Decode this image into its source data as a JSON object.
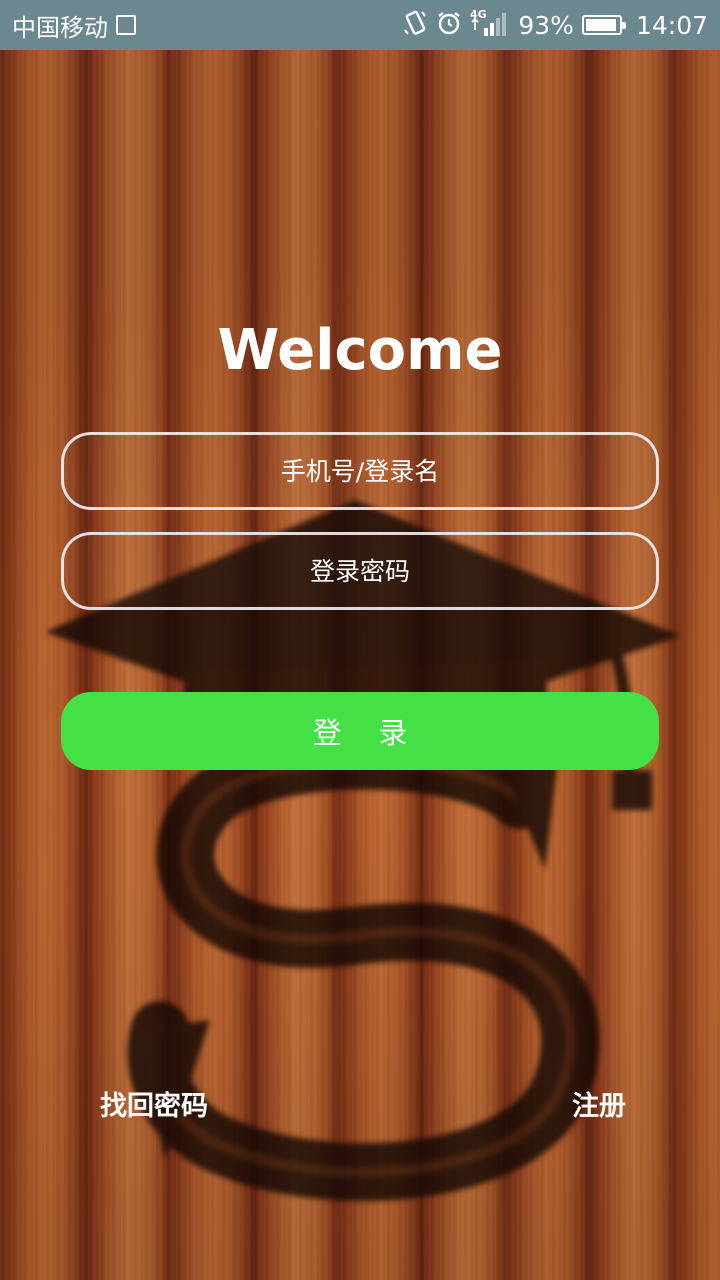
{
  "status_bar": {
    "carrier": "中国移动",
    "network": "4G",
    "battery_percent": "93%",
    "battery_level": 0.93,
    "time": "14:07",
    "icons": [
      "image-icon",
      "vibrate-icon",
      "alarm-icon",
      "signal-icon",
      "battery-icon"
    ]
  },
  "login": {
    "title": "Welcome",
    "username_placeholder": "手机号/登录名",
    "username_value": "",
    "password_placeholder": "登录密码",
    "password_value": "",
    "login_button": "登    录",
    "forgot_password": "找回密码",
    "register": "注册"
  },
  "colors": {
    "status_bar": "#6b8790",
    "login_button": "#45e045",
    "input_border": "#ebebf0",
    "text": "#ffffff"
  },
  "background": {
    "pattern": "wood-planks",
    "emblem": "graduation-cap-s-logo"
  }
}
